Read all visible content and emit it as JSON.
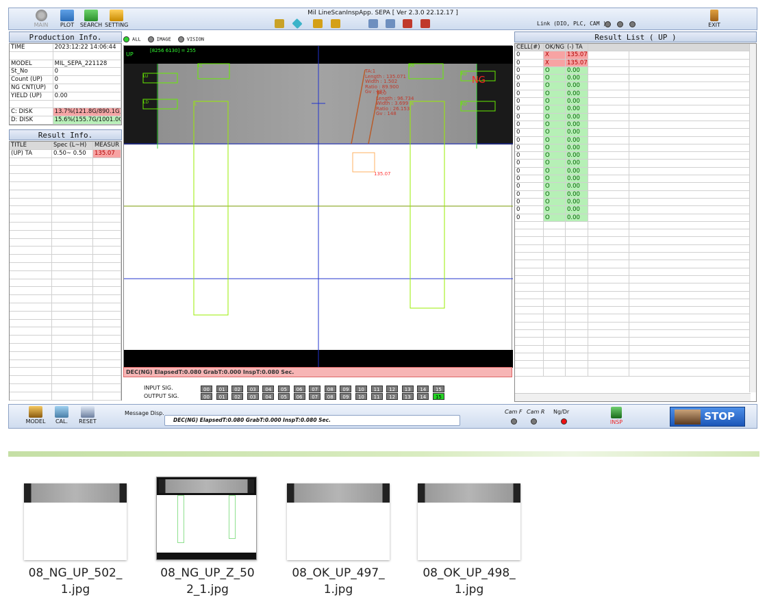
{
  "window": {
    "title": "Mil LineScanInspApp. SEPA [ Ver 2.3.0  22.12.17 ]",
    "link_label": "Link (DIO, PLC, CAM )"
  },
  "toolbar": {
    "main": "MAIN",
    "plot": "PLOT",
    "search": "SEARCH",
    "setting": "SETTING",
    "exit": "EXIT"
  },
  "production": {
    "title": "Production Info.",
    "rows": [
      {
        "k": "TIME",
        "v": "2023:12:22  14:06:44"
      },
      {
        "k": "",
        "v": ""
      },
      {
        "k": "MODEL",
        "v": "MIL_SEPA_221128"
      },
      {
        "k": "St_No",
        "v": "0"
      },
      {
        "k": "Count (UP)",
        "v": "0"
      },
      {
        "k": "NG CNT(UP)",
        "v": "0"
      },
      {
        "k": "YIELD (UP)",
        "v": "0.00"
      },
      {
        "k": "",
        "v": ""
      },
      {
        "k": "C: DISK",
        "v": "13.7%(121.8G/890.1G)"
      },
      {
        "k": "D: DISK",
        "v": "15.6%(155.7G/1001.0G)"
      }
    ]
  },
  "result_info": {
    "title": "Result Info.",
    "headers": [
      "TITLE",
      "Spec (L~H)",
      "MEASUR"
    ],
    "row": [
      "(UP) TA",
      "0.50~ 0.50",
      "135.07"
    ]
  },
  "tabs": [
    "ALL",
    "IMAGE",
    "VISION"
  ],
  "viewer": {
    "side": "UP",
    "coord": "[8256  6130] = 255",
    "verdict": "NG",
    "rois": [
      "LU",
      "LD",
      "RU",
      "RD",
      "LL",
      "RR",
      "L",
      "R"
    ],
    "ta1": [
      "TA:1",
      "Length : 135.071",
      "Width : 1.502",
      "Ratio : 89.900",
      "Gv : 187"
    ],
    "ta0": [
      "TA:0",
      "Length : 96.734",
      "Width : 3.699",
      "Ratio : 26.153",
      "Gv : 148"
    ],
    "defect_value": "135.07",
    "status_line": "DEC(NG)  ElapsedT:0.080  GrabT:0.000  InspT:0.080 Sec."
  },
  "signals": {
    "input_label": "INPUT   SIG.",
    "output_label": "OUTPUT SIG.",
    "channels": [
      "00",
      "01",
      "02",
      "03",
      "04",
      "05",
      "06",
      "07",
      "08",
      "09",
      "10",
      "11",
      "12",
      "13",
      "14",
      "15"
    ]
  },
  "result_list": {
    "title": "Result List ( UP )",
    "headers": [
      "CELL(#)",
      "OK/NG",
      "(-) TA"
    ],
    "rows": [
      [
        "0",
        "X",
        "135.07"
      ],
      [
        "0",
        "X",
        "135.07"
      ],
      [
        "0",
        "O",
        "0.00"
      ],
      [
        "0",
        "O",
        "0.00"
      ],
      [
        "0",
        "O",
        "0.00"
      ],
      [
        "0",
        "O",
        "0.00"
      ],
      [
        "0",
        "O",
        "0.00"
      ],
      [
        "0",
        "O",
        "0.00"
      ],
      [
        "0",
        "O",
        "0.00"
      ],
      [
        "0",
        "O",
        "0.00"
      ],
      [
        "0",
        "O",
        "0.00"
      ],
      [
        "0",
        "O",
        "0.00"
      ],
      [
        "0",
        "O",
        "0.00"
      ],
      [
        "0",
        "O",
        "0.00"
      ],
      [
        "0",
        "O",
        "0.00"
      ],
      [
        "0",
        "O",
        "0.00"
      ],
      [
        "0",
        "O",
        "0.00"
      ],
      [
        "0",
        "O",
        "0.00"
      ],
      [
        "0",
        "O",
        "0.00"
      ],
      [
        "0",
        "O",
        "0.00"
      ],
      [
        "0",
        "O",
        "0.00"
      ],
      [
        "0",
        "O",
        "0.00"
      ]
    ]
  },
  "bottom": {
    "model": "MODEL",
    "cal": "CAL.",
    "reset": "RESET",
    "message_label": "Message Disp.",
    "message": "DEC(NG)  ElapsedT:0.080  GrabT:0.000 InspT:0.080 Sec.",
    "cam_f": "Cam F",
    "cam_r": "Cam R",
    "ng_dr": "Ng/Dr",
    "insp": "INSP",
    "stop": "STOP"
  },
  "files": [
    {
      "name": "08_NG_UP_502_\n1.jpg"
    },
    {
      "name": "08_NG_UP_Z_50\n2_1.jpg"
    },
    {
      "name": "08_OK_UP_497_\n1.jpg"
    },
    {
      "name": "08_OK_UP_498_\n1.jpg"
    }
  ],
  "colors": {
    "accent": "#25d325",
    "ng": "#f7a3a3",
    "ok": "#b6f0b6",
    "stop": "#2b6fd1"
  }
}
